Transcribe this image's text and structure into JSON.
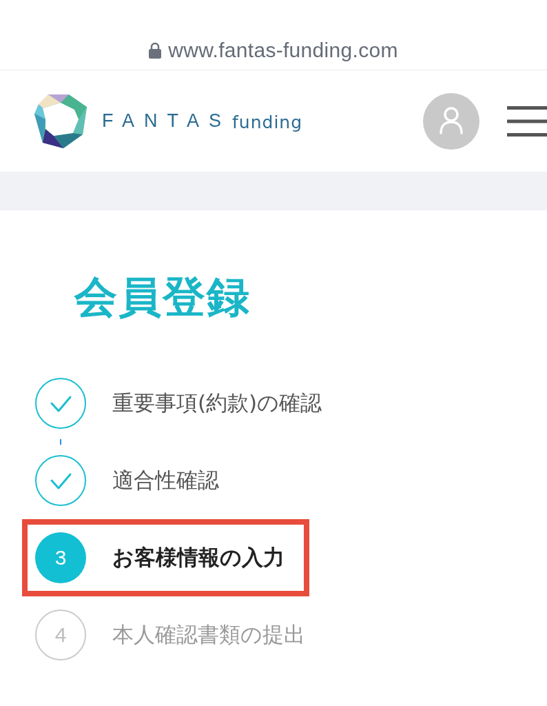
{
  "browser": {
    "url": "www.fantas-funding.com"
  },
  "header": {
    "brand": "FANTAS",
    "brand_sub": "funding"
  },
  "title": "会員登録",
  "steps": [
    {
      "label": "重要事項(約款)の確認",
      "kind": "done",
      "highlighted": false
    },
    {
      "label": "適合性確認",
      "kind": "done",
      "highlighted": false
    },
    {
      "number": "3",
      "label": "お客様情報の入力",
      "kind": "current",
      "highlighted": true
    },
    {
      "number": "4",
      "label": "本人確認書類の提出",
      "kind": "todo",
      "highlighted": false
    }
  ]
}
